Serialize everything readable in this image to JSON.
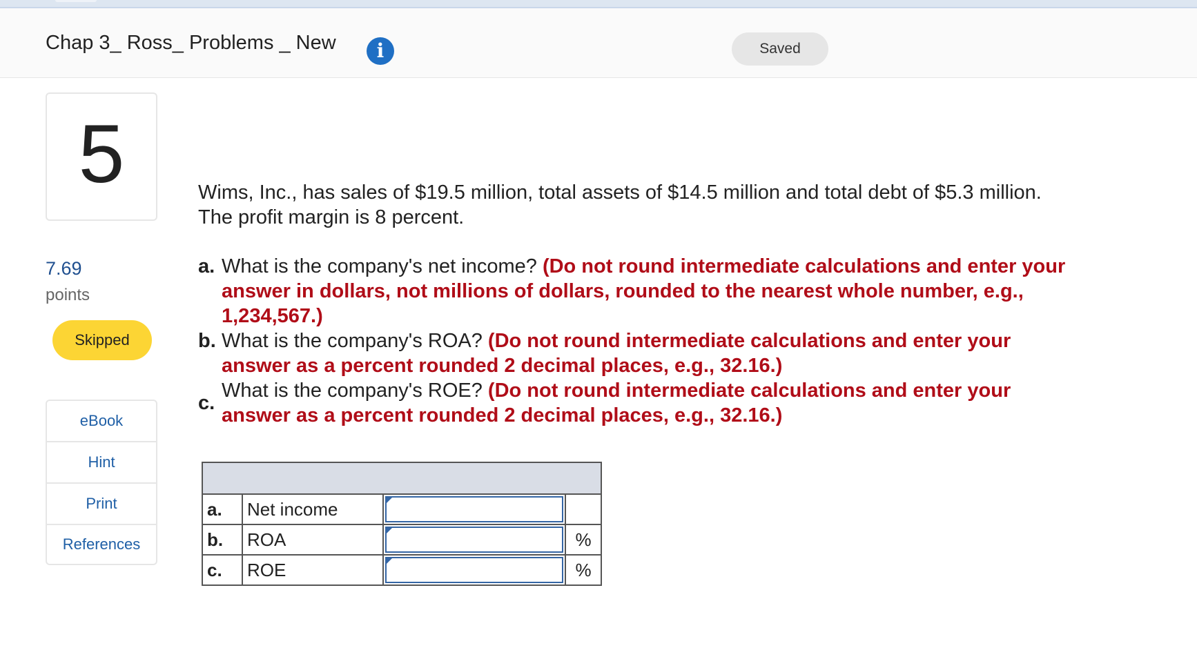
{
  "header": {
    "title": "Chap 3_ Ross_ Problems _ New",
    "info_icon_glyph": "i",
    "saved_label": "Saved"
  },
  "question": {
    "number": "5",
    "points_value": "7.69",
    "points_label": "points",
    "status_label": "Skipped",
    "stem": "Wims, Inc., has sales of $19.5 million, total assets of $14.5 million and total debt of $5.3 million. The profit margin is 8 percent.",
    "parts": [
      {
        "letter": "a.",
        "text": "What is the company's net income?",
        "instruction": "(Do not round intermediate calculations and enter your answer in dollars, not millions of dollars, rounded to the nearest whole number, e.g., 1,234,567.)"
      },
      {
        "letter": "b.",
        "text": "What is the company's ROA?",
        "instruction": "(Do not round intermediate calculations and enter your answer as a percent rounded 2 decimal places, e.g., 32.16.)"
      },
      {
        "letter": "c.",
        "text": "What is the company's ROE?",
        "instruction": "(Do not round intermediate calculations and enter your answer as a percent rounded 2 decimal places, e.g., 32.16.)"
      }
    ]
  },
  "tools": {
    "ebook": "eBook",
    "hint": "Hint",
    "print": "Print",
    "references": "References"
  },
  "answer_table": {
    "rows": [
      {
        "letter": "a.",
        "label": "Net income",
        "value": "",
        "unit": ""
      },
      {
        "letter": "b.",
        "label": "ROA",
        "value": "",
        "unit": "%"
      },
      {
        "letter": "c.",
        "label": "ROE",
        "value": "",
        "unit": "%"
      }
    ]
  },
  "colors": {
    "accent_blue": "#1f6fc4",
    "instruction_red": "#b00d18",
    "skipped_yellow": "#fcd534",
    "link_blue": "#1f5fa6"
  }
}
